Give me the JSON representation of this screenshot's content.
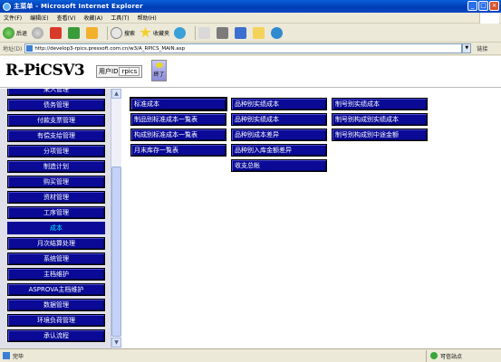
{
  "window": {
    "title": "主菜单 - Microsoft Internet Explorer",
    "controls": [
      "_",
      "□",
      "×"
    ]
  },
  "menu": [
    "文件(F)",
    "编辑(E)",
    "查看(V)",
    "收藏(A)",
    "工具(T)",
    "帮助(H)"
  ],
  "toolbar": {
    "back": "后退",
    "search": "搜索",
    "favorites": "收藏夹"
  },
  "address": {
    "label": "地址(D)",
    "url": "http://develop3-rpics.pressoft.com.cn/w3/A_RPICS_MAIN.asp",
    "go": "链接"
  },
  "header": {
    "logo": "R-PiCSV3",
    "user_label": "用户ID",
    "user_value": "rpics",
    "end_button": "終了"
  },
  "nav": [
    {
      "label": "采入管理",
      "active": false
    },
    {
      "label": "债务管理",
      "active": false
    },
    {
      "label": "付款支票管理",
      "active": false
    },
    {
      "label": "有偿支给管理",
      "active": false
    },
    {
      "label": "分项管理",
      "active": false
    },
    {
      "label": "制造计划",
      "active": false
    },
    {
      "label": "购买管理",
      "active": false
    },
    {
      "label": "资材管理",
      "active": false
    },
    {
      "label": "工序管理",
      "active": false
    },
    {
      "label": "成本",
      "active": true
    },
    {
      "label": "月次结算处理",
      "active": false
    },
    {
      "label": "系统管理",
      "active": false
    },
    {
      "label": "主档维护",
      "active": false
    },
    {
      "label": "ASPROVA主档维护",
      "active": false
    },
    {
      "label": "数据管理",
      "active": false
    },
    {
      "label": "环境负荷管理",
      "active": false
    },
    {
      "label": "承认流程",
      "active": false
    }
  ],
  "main": {
    "columns": [
      [
        "标准成本",
        "制品别标准成本一覧表",
        "构成别标准成本一覧表",
        "月末库存一覧表"
      ],
      [
        "品种别实绩成本",
        "品种别实绩成本",
        "品种别成本差异",
        "品种别入库金额差异",
        "收支总帐"
      ],
      [
        "制号别实绩成本",
        "制号别构成别实绩成本",
        "制号别构成别中途金额"
      ]
    ]
  },
  "status": {
    "text": "完毕",
    "zone": "可信站点"
  }
}
